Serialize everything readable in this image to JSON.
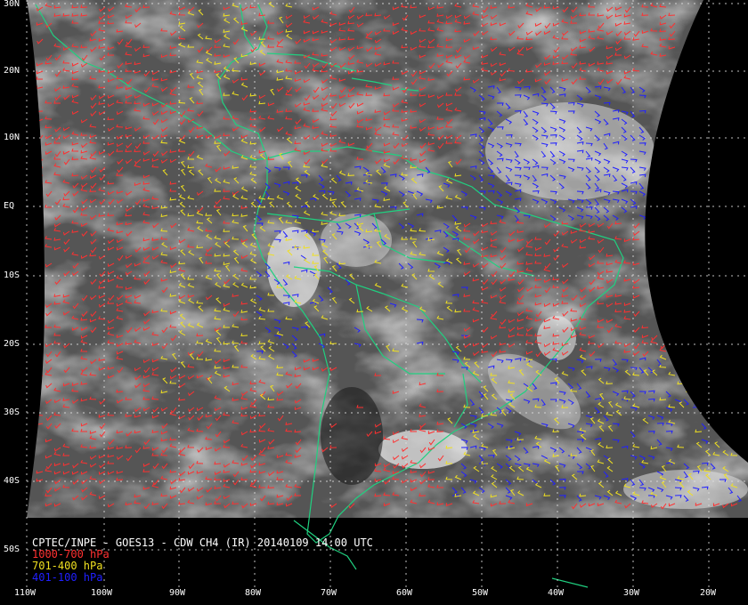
{
  "caption": {
    "title": "CPTEC/INPE - GOES13 - CDW CH4 (IR) 20140109 14:00 UTC",
    "legend": [
      {
        "label": "1000-700 hPa",
        "color": "#ff3030"
      },
      {
        "label": "701-400 hPa",
        "color": "#f0e020"
      },
      {
        "label": "401-100 hPa",
        "color": "#2020ff"
      }
    ]
  },
  "lat_labels": [
    "30N",
    "20N",
    "10N",
    "EQ",
    "10S",
    "20S",
    "30S",
    "40S",
    "50S"
  ],
  "lon_labels": [
    "110W",
    "100W",
    "90W",
    "80W",
    "70W",
    "60W",
    "50W",
    "40W",
    "30W",
    "20W"
  ],
  "colors": {
    "coastline": "#20d080",
    "grid": "#e0e0e0",
    "background": "#000000",
    "cloud": "#e8e8e8",
    "sea": "#5a5a5a"
  }
}
